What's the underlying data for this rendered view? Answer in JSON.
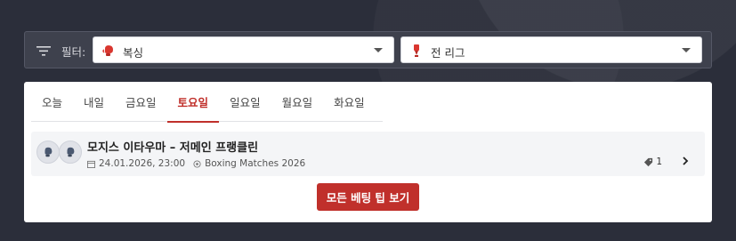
{
  "filter": {
    "label": "필터:",
    "icon": "filter-icon",
    "sport_select": {
      "value": "복싱",
      "icon": "boxing-glove-icon"
    },
    "league_select": {
      "value": "전 리그",
      "icon": "trophy-icon"
    }
  },
  "tabs": [
    {
      "label": "오늘",
      "active": false
    },
    {
      "label": "내일",
      "active": false
    },
    {
      "label": "금요일",
      "active": false
    },
    {
      "label": "토요일",
      "active": true
    },
    {
      "label": "일요일",
      "active": false
    },
    {
      "label": "월요일",
      "active": false
    },
    {
      "label": "화요일",
      "active": false
    }
  ],
  "match": {
    "title": "모지스 이타우마 – 저메인 프랭클린",
    "datetime": "24.01.2026, 23:00",
    "competition": "Boxing Matches 2026",
    "tip_count": "1"
  },
  "cta_label": "모든 베팅 팁 보기",
  "colors": {
    "accent": "#c0302b",
    "background": "#2b2e3a",
    "filter_bar": "#3e414d"
  }
}
